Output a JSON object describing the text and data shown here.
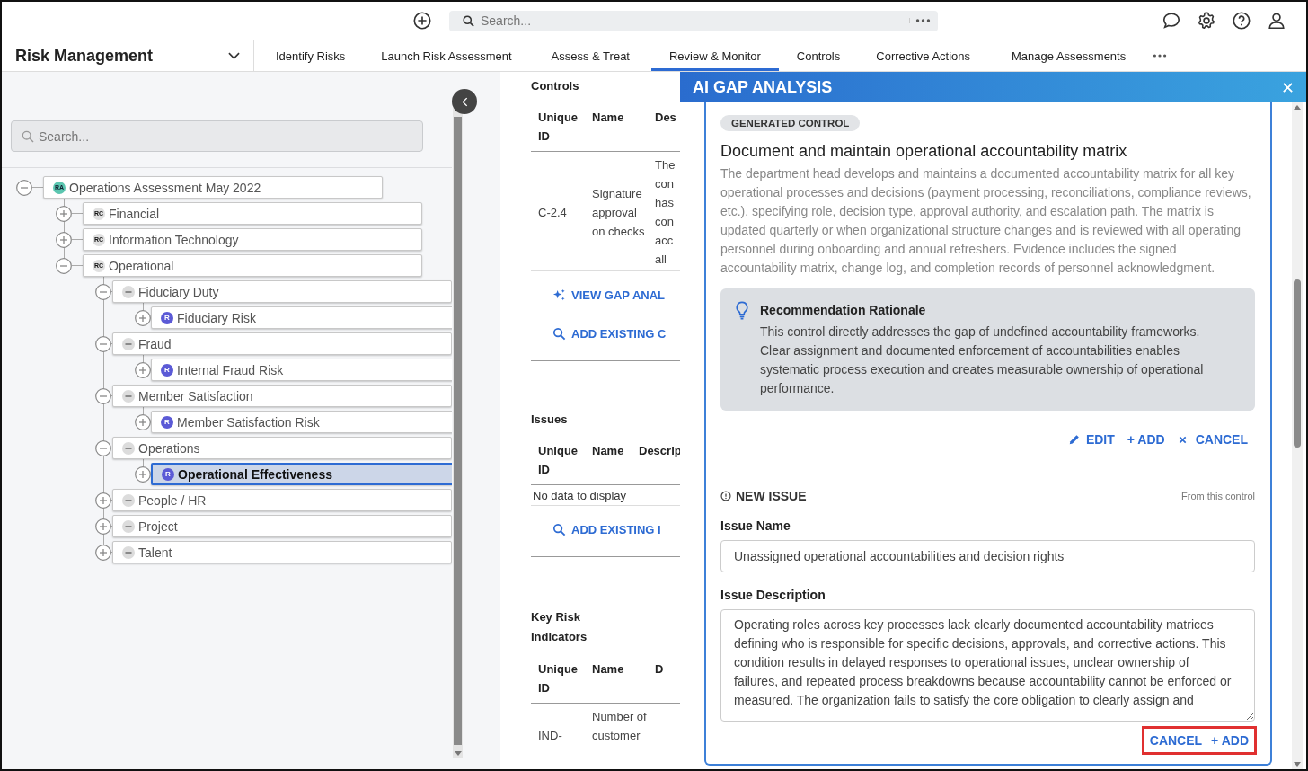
{
  "top_bar": {
    "search": {
      "placeholder": "Search..."
    }
  },
  "nav": {
    "module": "Risk Management",
    "tabs": [
      {
        "label": "Identify Risks",
        "selected": false
      },
      {
        "label": "Launch Risk Assessment",
        "selected": false
      },
      {
        "label": "Assess & Treat",
        "selected": false
      },
      {
        "label": "Review & Monitor",
        "selected": true
      },
      {
        "label": "Controls",
        "selected": false
      },
      {
        "label": "Corrective Actions",
        "selected": false
      },
      {
        "label": "Manage Assessments",
        "selected": false
      }
    ]
  },
  "sidebar": {
    "search": {
      "placeholder": "Search..."
    },
    "tree": [
      {
        "label": "Operations Assessment May 2022",
        "kind": "assessment",
        "badge": "RA",
        "expanded": true,
        "selected": false,
        "children": [
          {
            "label": "Financial",
            "kind": "category",
            "badge": "RC",
            "expanded": false,
            "selected": false
          },
          {
            "label": "Information Technology",
            "kind": "category",
            "badge": "RC",
            "expanded": false,
            "selected": false
          },
          {
            "label": "Operational",
            "kind": "category",
            "badge": "RC",
            "expanded": true,
            "selected": false,
            "children": [
              {
                "label": "Fiduciary Duty",
                "kind": "subcategory",
                "expanded": true,
                "selected": false,
                "children": [
                  {
                    "label": "Fiduciary Risk",
                    "kind": "risk",
                    "badge": "R",
                    "expanded": false,
                    "selected": false
                  }
                ]
              },
              {
                "label": "Fraud",
                "kind": "subcategory",
                "expanded": true,
                "selected": false,
                "children": [
                  {
                    "label": "Internal Fraud Risk",
                    "kind": "risk",
                    "badge": "R",
                    "expanded": false,
                    "selected": false
                  }
                ]
              },
              {
                "label": "Member Satisfaction",
                "kind": "subcategory",
                "expanded": true,
                "selected": false,
                "children": [
                  {
                    "label": "Member Satisfaction Risk",
                    "kind": "risk",
                    "badge": "R",
                    "expanded": false,
                    "selected": false
                  }
                ]
              },
              {
                "label": "Operations",
                "kind": "subcategory",
                "expanded": true,
                "selected": false,
                "children": [
                  {
                    "label": "Operational Effectiveness",
                    "kind": "risk",
                    "badge": "R",
                    "expanded": false,
                    "selected": true
                  }
                ]
              },
              {
                "label": "People / HR",
                "kind": "subcategory",
                "expanded": false,
                "selected": false
              },
              {
                "label": "Project",
                "kind": "subcategory",
                "expanded": false,
                "selected": false
              },
              {
                "label": "Talent",
                "kind": "subcategory",
                "expanded": false,
                "selected": false
              }
            ]
          }
        ]
      }
    ]
  },
  "sections": [
    {
      "title": "Controls",
      "columns": [
        "Unique ID",
        "Name",
        "Des"
      ],
      "rows": [
        [
          "C-2.4",
          "Signature approval on checks",
          [
            "The",
            "con",
            "has",
            "con",
            "acc",
            "all"
          ]
        ]
      ],
      "links": [
        {
          "kind": "sparkle",
          "label": "VIEW GAP ANAL"
        },
        {
          "kind": "search",
          "label": "ADD EXISTING C"
        }
      ]
    },
    {
      "title": "Issues",
      "columns": [
        "Unique ID",
        "Name",
        "Descrip"
      ],
      "empty_text": "No data to display",
      "links": [
        {
          "kind": "search",
          "label": "ADD EXISTING I"
        }
      ]
    },
    {
      "title": "Key Risk Indicators",
      "columns": [
        "Unique ID",
        "Name",
        "D"
      ],
      "rows": [
        [
          "IND-",
          "Number of customer",
          []
        ]
      ]
    }
  ],
  "drawer": {
    "title": "AI GAP ANALYSIS",
    "control": {
      "tag": "GENERATED CONTROL",
      "title": "Document and maintain operational accountability matrix",
      "description": "The department head develops and maintains a documented accountability matrix for all key operational processes and decisions (payment processing, reconciliations, compliance reviews, etc.), specifying role, decision type, approval authority, and escalation path. The matrix is updated quarterly or when organizational structure changes and is reviewed with all operating personnel during onboarding and annual refreshers. Evidence includes the signed accountability matrix, change log, and completion records of personnel acknowledgment.",
      "rationale_title": "Recommendation Rationale",
      "rationale": "This control directly addresses the gap of undefined accountability frameworks. Clear assignment and documented enforcement of accountabilities enables systematic process execution and creates measurable ownership of operational performance.",
      "actions": [
        {
          "kind": "edit",
          "label": "EDIT"
        },
        {
          "kind": "add",
          "label": "+ ADD"
        },
        {
          "kind": "cancel",
          "label": "CANCEL"
        }
      ]
    },
    "new_issue": {
      "title": "NEW ISSUE",
      "source": "From this control",
      "name_label": "Issue Name",
      "name_value": "Unassigned operational accountabilities and decision rights",
      "description_label": "Issue Description",
      "description_value": "Operating roles across key processes lack clearly documented accountability matrices defining who is responsible for specific decisions, approvals, and corrective actions. This condition results in delayed responses to operational issues, unclear ownership of failures, and repeated process breakdowns because accountability cannot be enforced or measured. The organization fails to satisfy the core obligation to clearly assign and",
      "buttons": [
        "CANCEL",
        "+ ADD"
      ]
    }
  }
}
